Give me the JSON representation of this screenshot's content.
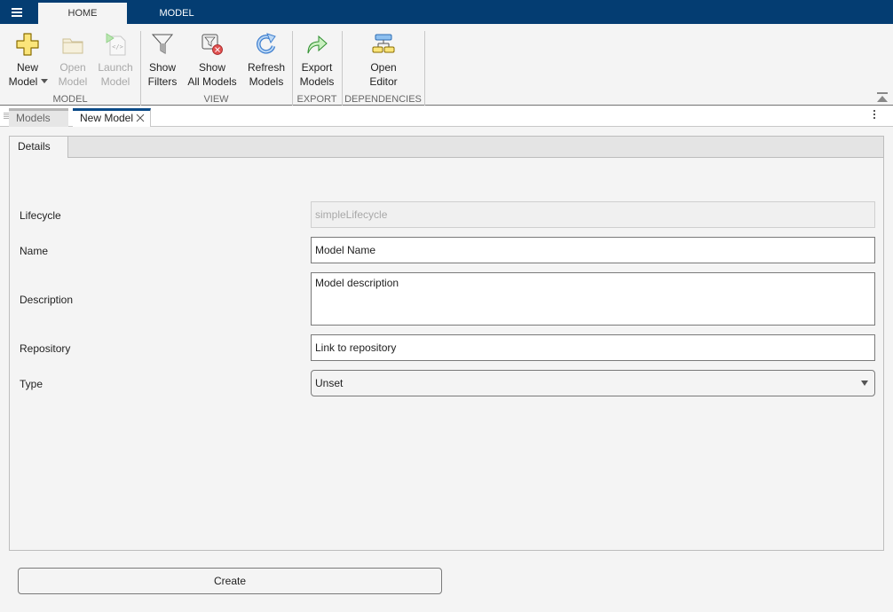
{
  "toolstrip": {
    "tabs": [
      {
        "label": "HOME",
        "active": true
      },
      {
        "label": "MODEL",
        "active": false
      }
    ],
    "groups": [
      {
        "label": "MODEL",
        "buttons": [
          {
            "line1": "New",
            "line2": "Model",
            "icon": "plus-icon",
            "enabled": true,
            "has_dropdown": true
          },
          {
            "line1": "Open",
            "line2": "Model",
            "icon": "folder-icon",
            "enabled": false
          },
          {
            "line1": "Launch",
            "line2": "Model",
            "icon": "launch-icon",
            "enabled": false
          }
        ]
      },
      {
        "label": "VIEW",
        "buttons": [
          {
            "line1": "Show",
            "line2": "Filters",
            "icon": "filter-icon",
            "enabled": true
          },
          {
            "line1": "Show",
            "line2": "All Models",
            "icon": "clear-filter-icon",
            "enabled": true
          },
          {
            "line1": "Refresh",
            "line2": "Models",
            "icon": "refresh-icon",
            "enabled": true
          }
        ]
      },
      {
        "label": "EXPORT",
        "buttons": [
          {
            "line1": "Export",
            "line2": "Models",
            "icon": "export-arrow-icon",
            "enabled": true
          }
        ]
      },
      {
        "label": "DEPENDENCIES",
        "buttons": [
          {
            "line1": "Open",
            "line2": "Editor",
            "icon": "hierarchy-icon",
            "enabled": true
          }
        ]
      }
    ]
  },
  "document_tabs": [
    {
      "label": "Models",
      "active": false,
      "closable": false
    },
    {
      "label": "New Model",
      "active": true,
      "closable": true
    }
  ],
  "panel": {
    "tab_label": "Details",
    "fields": {
      "lifecycle": {
        "label": "Lifecycle",
        "value": "simpleLifecycle",
        "enabled": false
      },
      "name": {
        "label": "Name",
        "value": "Model Name"
      },
      "description": {
        "label": "Description",
        "value": "Model description"
      },
      "repository": {
        "label": "Repository",
        "value": "Link to repository"
      },
      "type": {
        "label": "Type",
        "value": "Unset"
      }
    }
  },
  "create_button": "Create",
  "colors": {
    "title_bar": "#043d72",
    "active_tab_accent": "#0b4a87",
    "background": "#f4f4f4"
  }
}
